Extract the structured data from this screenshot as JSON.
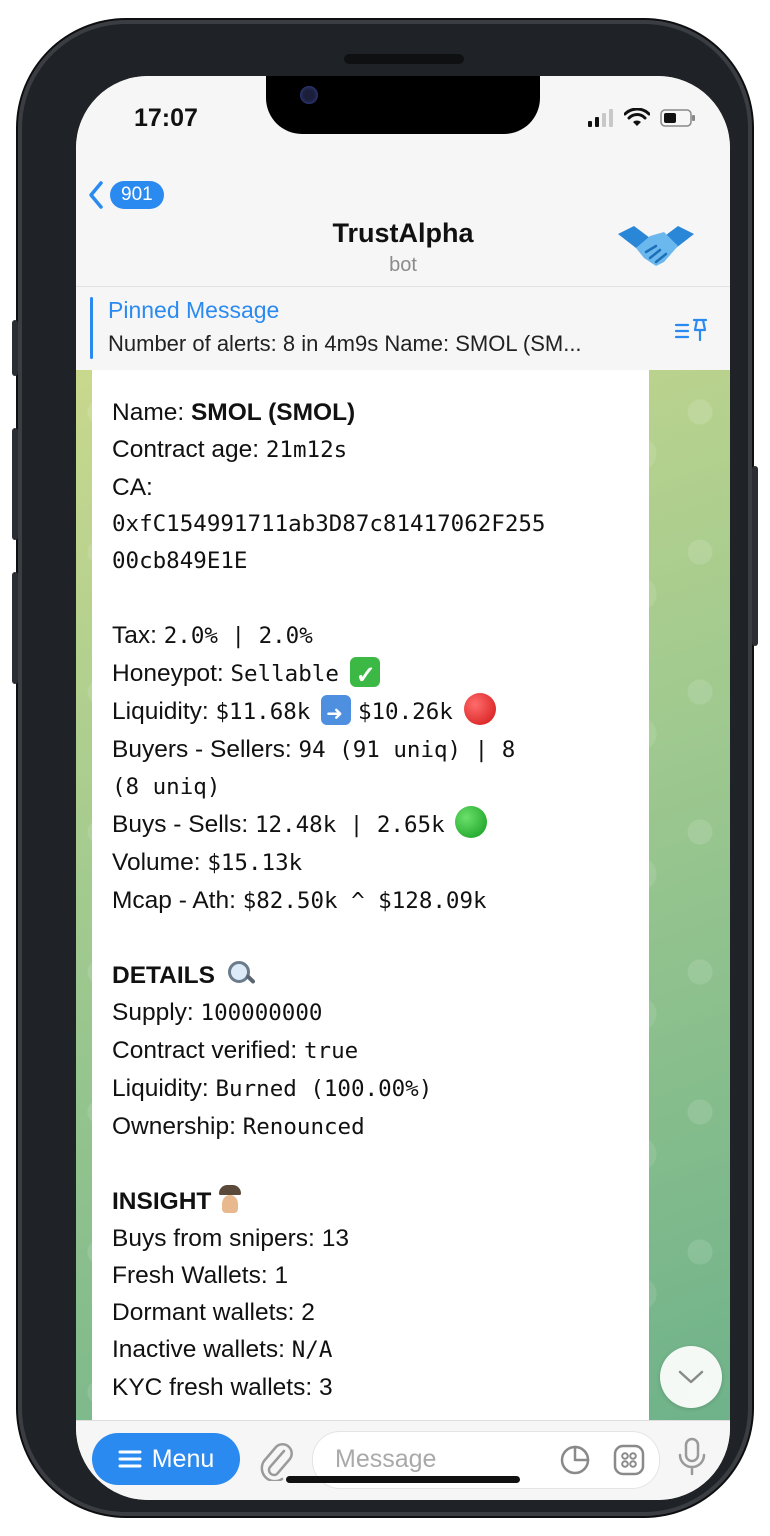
{
  "status": {
    "time": "17:07"
  },
  "header": {
    "back_count": "901",
    "title": "TrustAlpha",
    "subtitle": "bot",
    "avatar_icon": "handshake-icon"
  },
  "pinned": {
    "label": "Pinned Message",
    "text": "Number of alerts: 8 in 4m9s Name: SMOL (SM..."
  },
  "message": {
    "name_label": "Name: ",
    "name_value": "SMOL (SMOL)",
    "contract_age_label": "Contract age: ",
    "contract_age_value": "21m12s",
    "ca_label": "CA:",
    "ca_line1": "0xfC154991711ab3D87c81417062F255",
    "ca_line2": "00cb849E1E",
    "tax_label": "Tax: ",
    "tax_value": "2.0% | 2.0%",
    "honeypot_label": "Honeypot: ",
    "honeypot_value": "Sellable",
    "liquidity_label": "Liquidity: ",
    "liquidity_from": "$11.68k",
    "liquidity_to": "$10.26k",
    "buyers_sellers_label": "Buyers - Sellers: ",
    "buyers_sellers_value1": "94 (91 uniq) | 8",
    "buyers_sellers_value2": "(8 uniq)",
    "buys_sells_label": "Buys - Sells: ",
    "buys_sells_value": "12.48k | 2.65k",
    "volume_label": "Volume: ",
    "volume_value": "$15.13k",
    "mcap_label": "Mcap - Ath: ",
    "mcap_value": "$82.50k ^ $128.09k",
    "details_heading": "DETAILS",
    "supply_label": "Supply: ",
    "supply_value": "100000000",
    "verified_label": "Contract verified: ",
    "verified_value": "true",
    "liq2_label": "Liquidity: ",
    "liq2_value": "Burned (100.00%)",
    "ownership_label": "Ownership: ",
    "ownership_value": "Renounced",
    "insight_heading": "INSIGHT",
    "snipers_label": "Buys from snipers: ",
    "snipers_value": "13",
    "fresh_label": "Fresh Wallets: ",
    "fresh_value": "1",
    "dormant_label": "Dormant wallets: ",
    "dormant_value": "2",
    "inactive_label": "Inactive wallets: ",
    "inactive_value": "N/A",
    "kyc_label": "KYC fresh wallets: ",
    "kyc_value": "3"
  },
  "input": {
    "menu_label": "Menu",
    "placeholder": "Message"
  },
  "colors": {
    "accent": "#2b8af0",
    "chat_bg_top": "#c9d88d",
    "chat_bg_bottom": "#6fb28a"
  }
}
